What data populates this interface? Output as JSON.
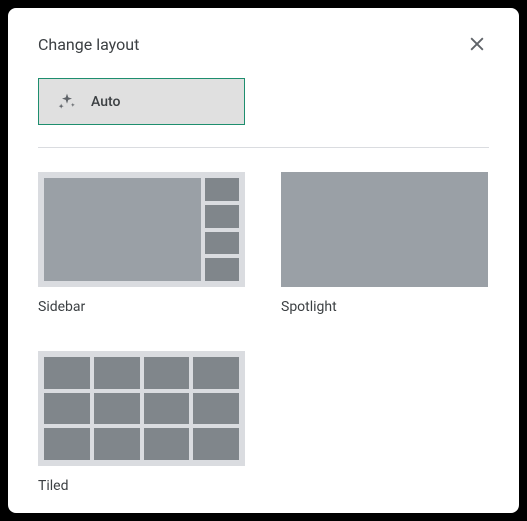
{
  "dialog": {
    "title": "Change layout"
  },
  "auto": {
    "label": "Auto"
  },
  "layouts": {
    "sidebar": {
      "label": "Sidebar"
    },
    "spotlight": {
      "label": "Spotlight"
    },
    "tiled": {
      "label": "Tiled"
    }
  }
}
